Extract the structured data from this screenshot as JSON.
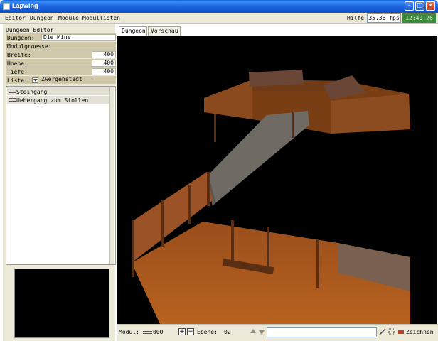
{
  "window": {
    "title": "Lapwing"
  },
  "menu": {
    "items": [
      "Editor",
      "Dungeon",
      "Module",
      "Modullisten"
    ],
    "help": "Hilfe",
    "fps": "35.36 fps",
    "clock": "12:40:26"
  },
  "editor": {
    "heading": "Dungeon Editor",
    "dungeon_label": "Dungeon:",
    "dungeon_value": "Die Mine",
    "module_size_label": "Modulgroesse:",
    "width_label": "Breite:",
    "width_value": "400",
    "height_label": "Hoehe:",
    "height_value": "400",
    "depth_label": "Tiefe:",
    "depth_value": "400",
    "list_label": "Liste:",
    "list_value": "Zwergenstadt",
    "list_items": [
      "Steingang",
      "Uebergang zum Stollen"
    ]
  },
  "tabs": [
    "Dungeon",
    "Vorschau"
  ],
  "status": {
    "modul_label": "Modul:",
    "modul_value": "000",
    "plus": "+",
    "minus": "−",
    "ebene_label": "Ebene:",
    "ebene_value": "02",
    "input_value": "",
    "zeichne_label": "Zeichnen"
  },
  "icons": [
    "app-icon",
    "minimize-icon",
    "maximize-icon",
    "close-icon",
    "dropdown-arrow-icon",
    "line-icon",
    "arrow-up-icon",
    "arrow-down-icon",
    "pencil-icon",
    "select-icon",
    "eraser-icon"
  ],
  "colors": {
    "titlebar": "#1e66e0",
    "clock_bg": "#3c8a3c",
    "viewport_bg": "#000000",
    "wood": "#8a4a1e",
    "floor": "#a8541e"
  }
}
